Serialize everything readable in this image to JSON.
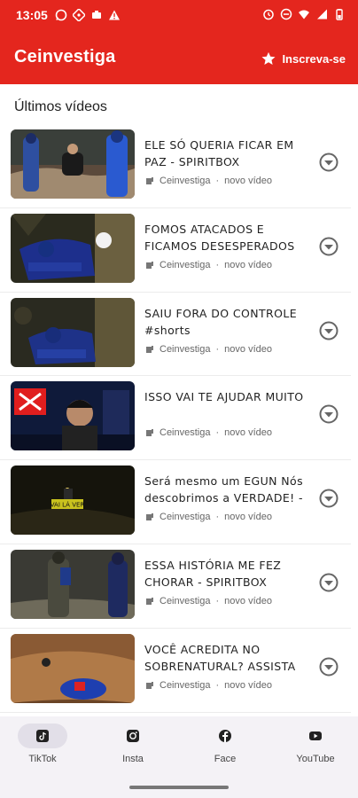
{
  "status_bar": {
    "time": "13:05",
    "left_icons": [
      "whatsapp-icon",
      "network-icon",
      "recording-icon",
      "warning-icon"
    ],
    "right_icons": [
      "alarm-icon",
      "dnd-icon",
      "wifi-icon",
      "signal-icon",
      "battery-icon"
    ]
  },
  "app_bar": {
    "title": "Ceinvestiga",
    "subscribe_label": "Inscreva-se",
    "subscribe_icon": "star-icon"
  },
  "section": {
    "title": "Últimos vídeos"
  },
  "videos": [
    {
      "title": "ELE SÓ QUERIA FICAR EM PAZ - SPIRITBOX",
      "channel": "Ceinvestiga",
      "badge": "novo vídeo"
    },
    {
      "title": "FOMOS ATACADOS E FICAMOS DESESPERADOS",
      "channel": "Ceinvestiga",
      "badge": "novo vídeo"
    },
    {
      "title": "SAIU FORA DO CONTROLE #shorts",
      "channel": "Ceinvestiga",
      "badge": "novo vídeo"
    },
    {
      "title": "ISSO VAI TE AJUDAR MUITO",
      "channel": "Ceinvestiga",
      "badge": "novo vídeo"
    },
    {
      "title": "Será mesmo um EGUN  Nós descobrimos a VERDADE! -",
      "channel": "Ceinvestiga",
      "badge": "novo vídeo"
    },
    {
      "title": "ESSA HISTÓRIA ME FEZ CHORAR - SPIRITBOX",
      "channel": "Ceinvestiga",
      "badge": "novo vídeo"
    },
    {
      "title": "VOCÊ ACREDITA NO SOBRENATURAL? ASSISTA O",
      "channel": "Ceinvestiga",
      "badge": "novo vídeo"
    }
  ],
  "thumbnail_caption": "VAI LÁ VER",
  "separator": "·",
  "bottom_nav": [
    {
      "label": "TikTok",
      "icon": "tiktok-icon",
      "active": true
    },
    {
      "label": "Insta",
      "icon": "instagram-icon",
      "active": false
    },
    {
      "label": "Face",
      "icon": "facebook-icon",
      "active": false
    },
    {
      "label": "YouTube",
      "icon": "youtube-icon",
      "active": false
    }
  ],
  "colors": {
    "brand": "#e4261e",
    "nav_bg": "#f4f2f6",
    "text": "#222222",
    "meta": "#666666"
  }
}
